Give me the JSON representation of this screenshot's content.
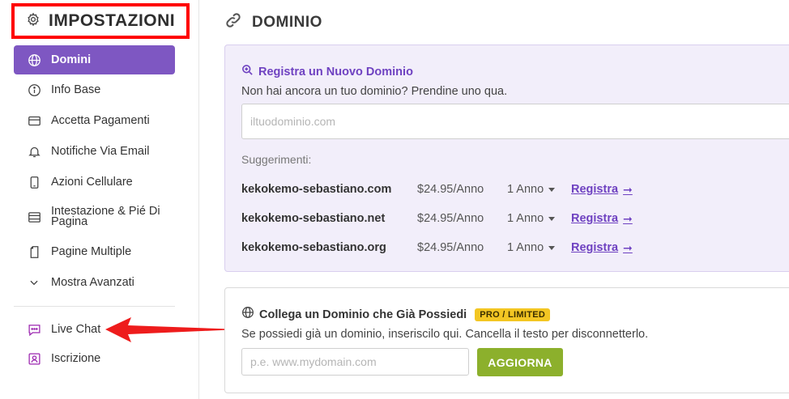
{
  "sidebar": {
    "title": "IMPOSTAZIONI",
    "items": [
      {
        "label": "Domini",
        "icon": "globe-icon",
        "active": true
      },
      {
        "label": "Info Base",
        "icon": "info-icon"
      },
      {
        "label": "Accetta Pagamenti",
        "icon": "credit-card-icon"
      },
      {
        "label": "Notifiche Via Email",
        "icon": "bell-icon"
      },
      {
        "label": "Azioni Cellulare",
        "icon": "mobile-icon"
      },
      {
        "label": "Intestazione & Pié Di Pagina",
        "icon": "layout-icon"
      },
      {
        "label": "Pagine Multiple",
        "icon": "pages-icon"
      },
      {
        "label": "Mostra Avanzati",
        "icon": "chevron-down-icon"
      }
    ],
    "secondary": [
      {
        "label": "Live Chat",
        "icon": "chat-icon"
      },
      {
        "label": "Iscrizione",
        "icon": "user-card-icon"
      }
    ]
  },
  "main": {
    "title": "DOMINIO",
    "register": {
      "heading": "Registra un Nuovo Dominio",
      "subtitle": "Non hai ancora un tuo dominio? Prendine uno qua.",
      "placeholder": "iltuodominio.com",
      "suggestions_label": "Suggerimenti:",
      "suggestions": [
        {
          "name": "kekokemo-sebastiano.com",
          "price": "$24.95/Anno",
          "term": "1 Anno",
          "action": "Registra"
        },
        {
          "name": "kekokemo-sebastiano.net",
          "price": "$24.95/Anno",
          "term": "1 Anno",
          "action": "Registra"
        },
        {
          "name": "kekokemo-sebastiano.org",
          "price": "$24.95/Anno",
          "term": "1 Anno",
          "action": "Registra"
        }
      ]
    },
    "connect": {
      "heading": "Collega un Dominio che Già Possiedi",
      "badge": "PRO / LIMITED",
      "subtitle": "Se possiedi già un dominio, inseriscilo qui. Cancella il testo per disconnetterlo.",
      "placeholder": "p.e. www.mydomain.com",
      "button": "AGGIORNA"
    }
  },
  "colors": {
    "accent": "#7e57c2",
    "link": "#6f42c1",
    "button": "#8cb02c",
    "badge": "#f3c623",
    "annotation": "#ff0000"
  }
}
